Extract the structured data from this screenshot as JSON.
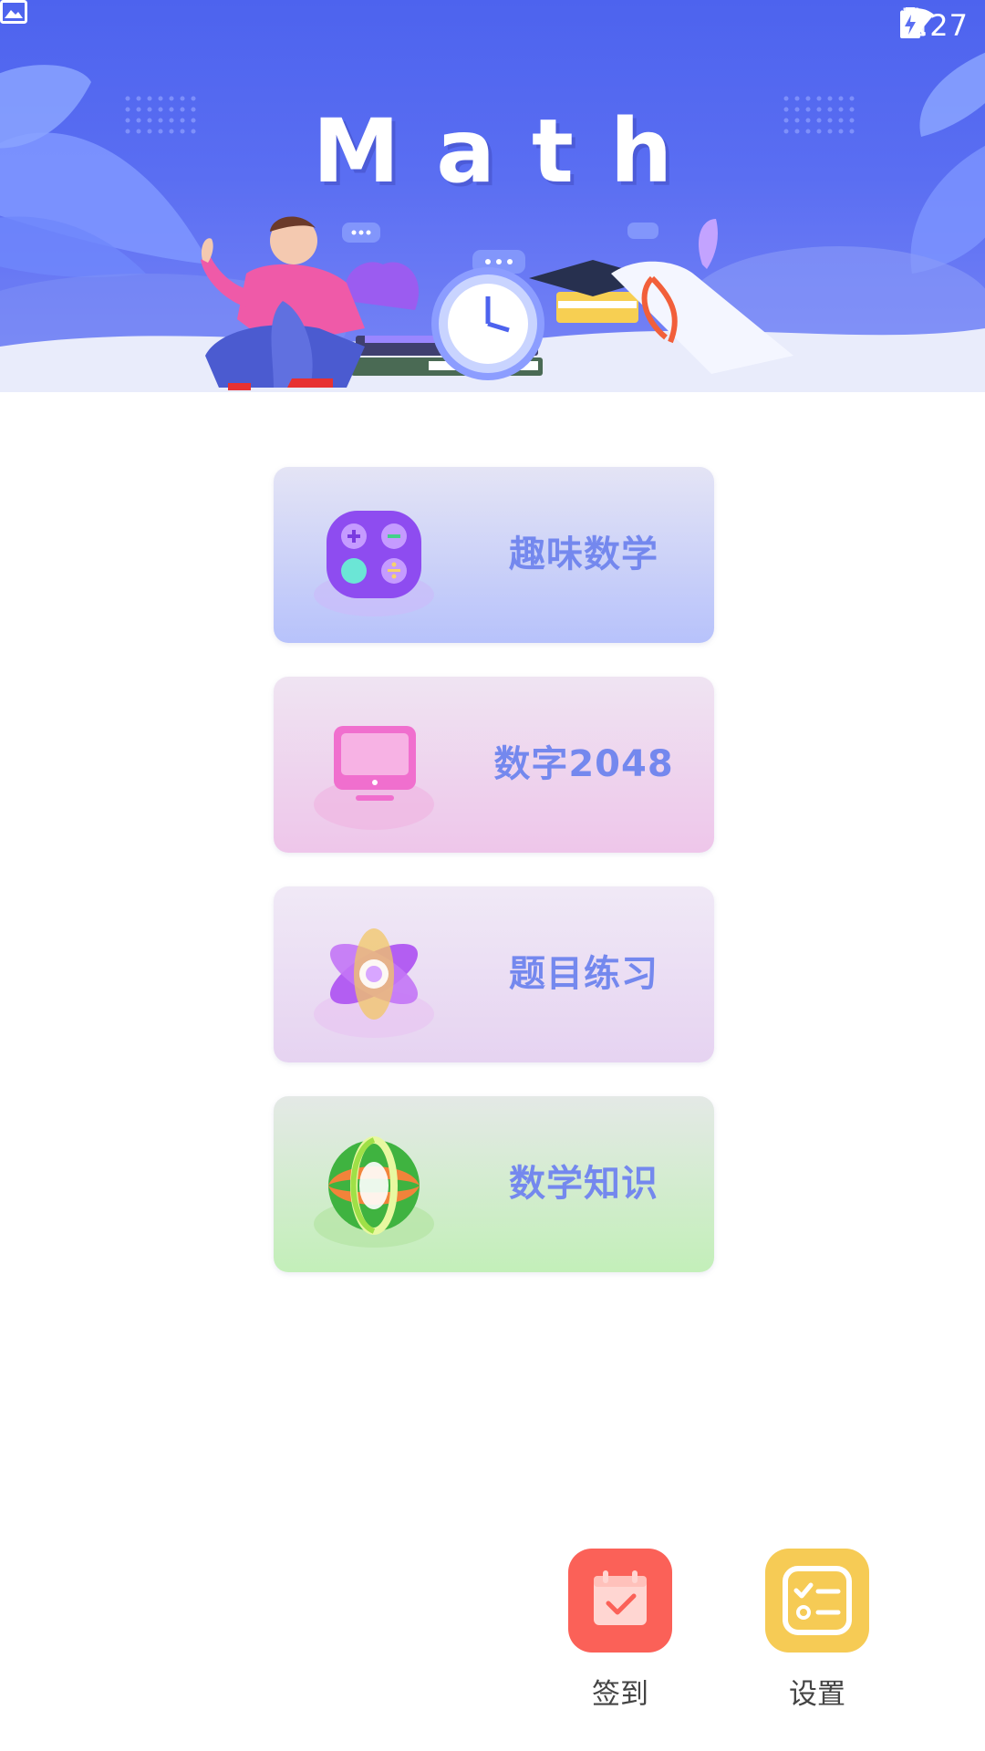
{
  "status_bar": {
    "left_icon": "image-icon",
    "icons": [
      "wifi-icon",
      "no-sim-icon",
      "battery-charging-icon"
    ],
    "time": "4:27"
  },
  "banner": {
    "title": "Math"
  },
  "menu": {
    "items": [
      {
        "label": "趣味数学",
        "icon": "calculator-icon",
        "color": "#7488ee"
      },
      {
        "label": "数字2048",
        "icon": "monitor-icon",
        "color": "#7488ee"
      },
      {
        "label": "题目练习",
        "icon": "atom-icon",
        "color": "#7488ee"
      },
      {
        "label": "数学知识",
        "icon": "globe-icon",
        "color": "#7488ee"
      }
    ]
  },
  "actions": {
    "signin": {
      "label": "签到",
      "icon": "calendar-check-icon",
      "color": "#fb6158"
    },
    "settings": {
      "label": "设置",
      "icon": "checklist-icon",
      "color": "#f6cb55"
    }
  },
  "colors": {
    "banner_blue": "#5a6ef2",
    "label_blue": "#7488ee"
  }
}
